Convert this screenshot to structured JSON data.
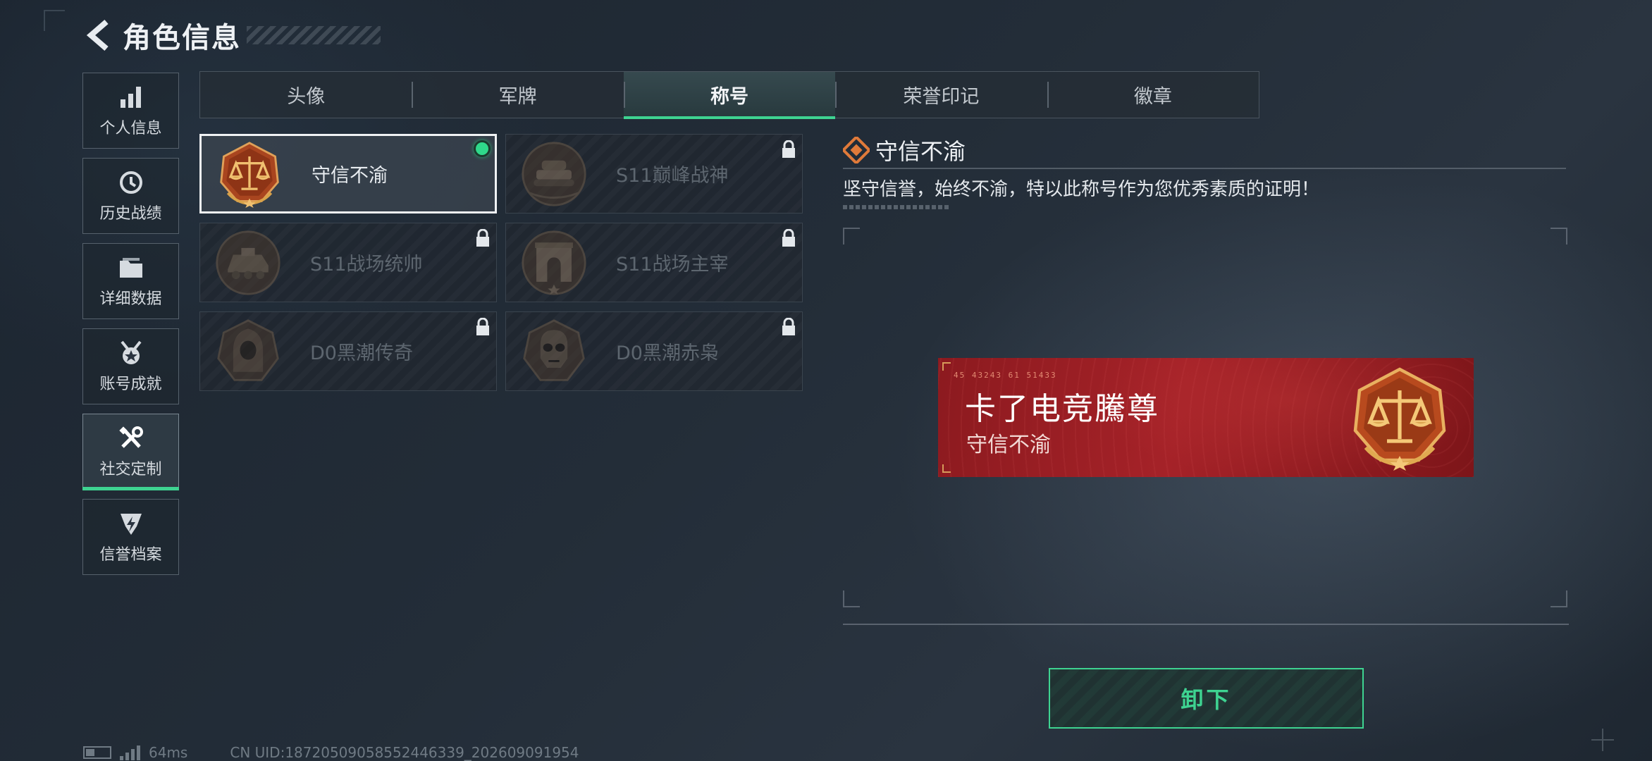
{
  "header": {
    "title": "角色信息"
  },
  "sidebar": {
    "items": [
      {
        "label": "个人信息",
        "icon": "bar-chart-icon"
      },
      {
        "label": "历史战绩",
        "icon": "history-clock-icon"
      },
      {
        "label": "详细数据",
        "icon": "folder-icon"
      },
      {
        "label": "账号成就",
        "icon": "achievement-medal-icon"
      },
      {
        "label": "社交定制",
        "icon": "tools-icon",
        "active": true
      },
      {
        "label": "信誉档案",
        "icon": "shield-badge-icon"
      }
    ]
  },
  "tabs": [
    {
      "label": "头像"
    },
    {
      "label": "军牌"
    },
    {
      "label": "称号",
      "active": true
    },
    {
      "label": "荣誉印记"
    },
    {
      "label": "徽章"
    }
  ],
  "titles": [
    {
      "name": "守信不渝",
      "emblem": "scales-emblem",
      "selected": true,
      "equipped": true,
      "locked": false
    },
    {
      "name": "S11巅峰战神",
      "emblem": "tank-emblem",
      "locked": true
    },
    {
      "name": "S11战场统帅",
      "emblem": "armored-vehicle-emblem",
      "locked": true
    },
    {
      "name": "S11战场主宰",
      "emblem": "arch-emblem",
      "locked": true
    },
    {
      "name": "D0黑潮传奇",
      "emblem": "hooded-figure-emblem",
      "locked": true
    },
    {
      "name": "D0黑潮赤枭",
      "emblem": "skull-mask-emblem",
      "locked": true
    }
  ],
  "detail": {
    "title": "守信不渝",
    "description": "坚守信誉，始终不渝，特以此称号作为您优秀素质的证明！"
  },
  "nameplate": {
    "code": "45 43243  61 51433",
    "player_name": "卡了电竞騰尊",
    "title": "守信不渝"
  },
  "actions": {
    "unequip_label": "卸下"
  },
  "footer": {
    "ping": "64ms",
    "uid": "CN UID:18720509058552446339_202609091954"
  },
  "colors": {
    "accent_green": "#3ed391",
    "nameplate_red": "#a52228",
    "emblem_bronze": "#b8733a"
  }
}
